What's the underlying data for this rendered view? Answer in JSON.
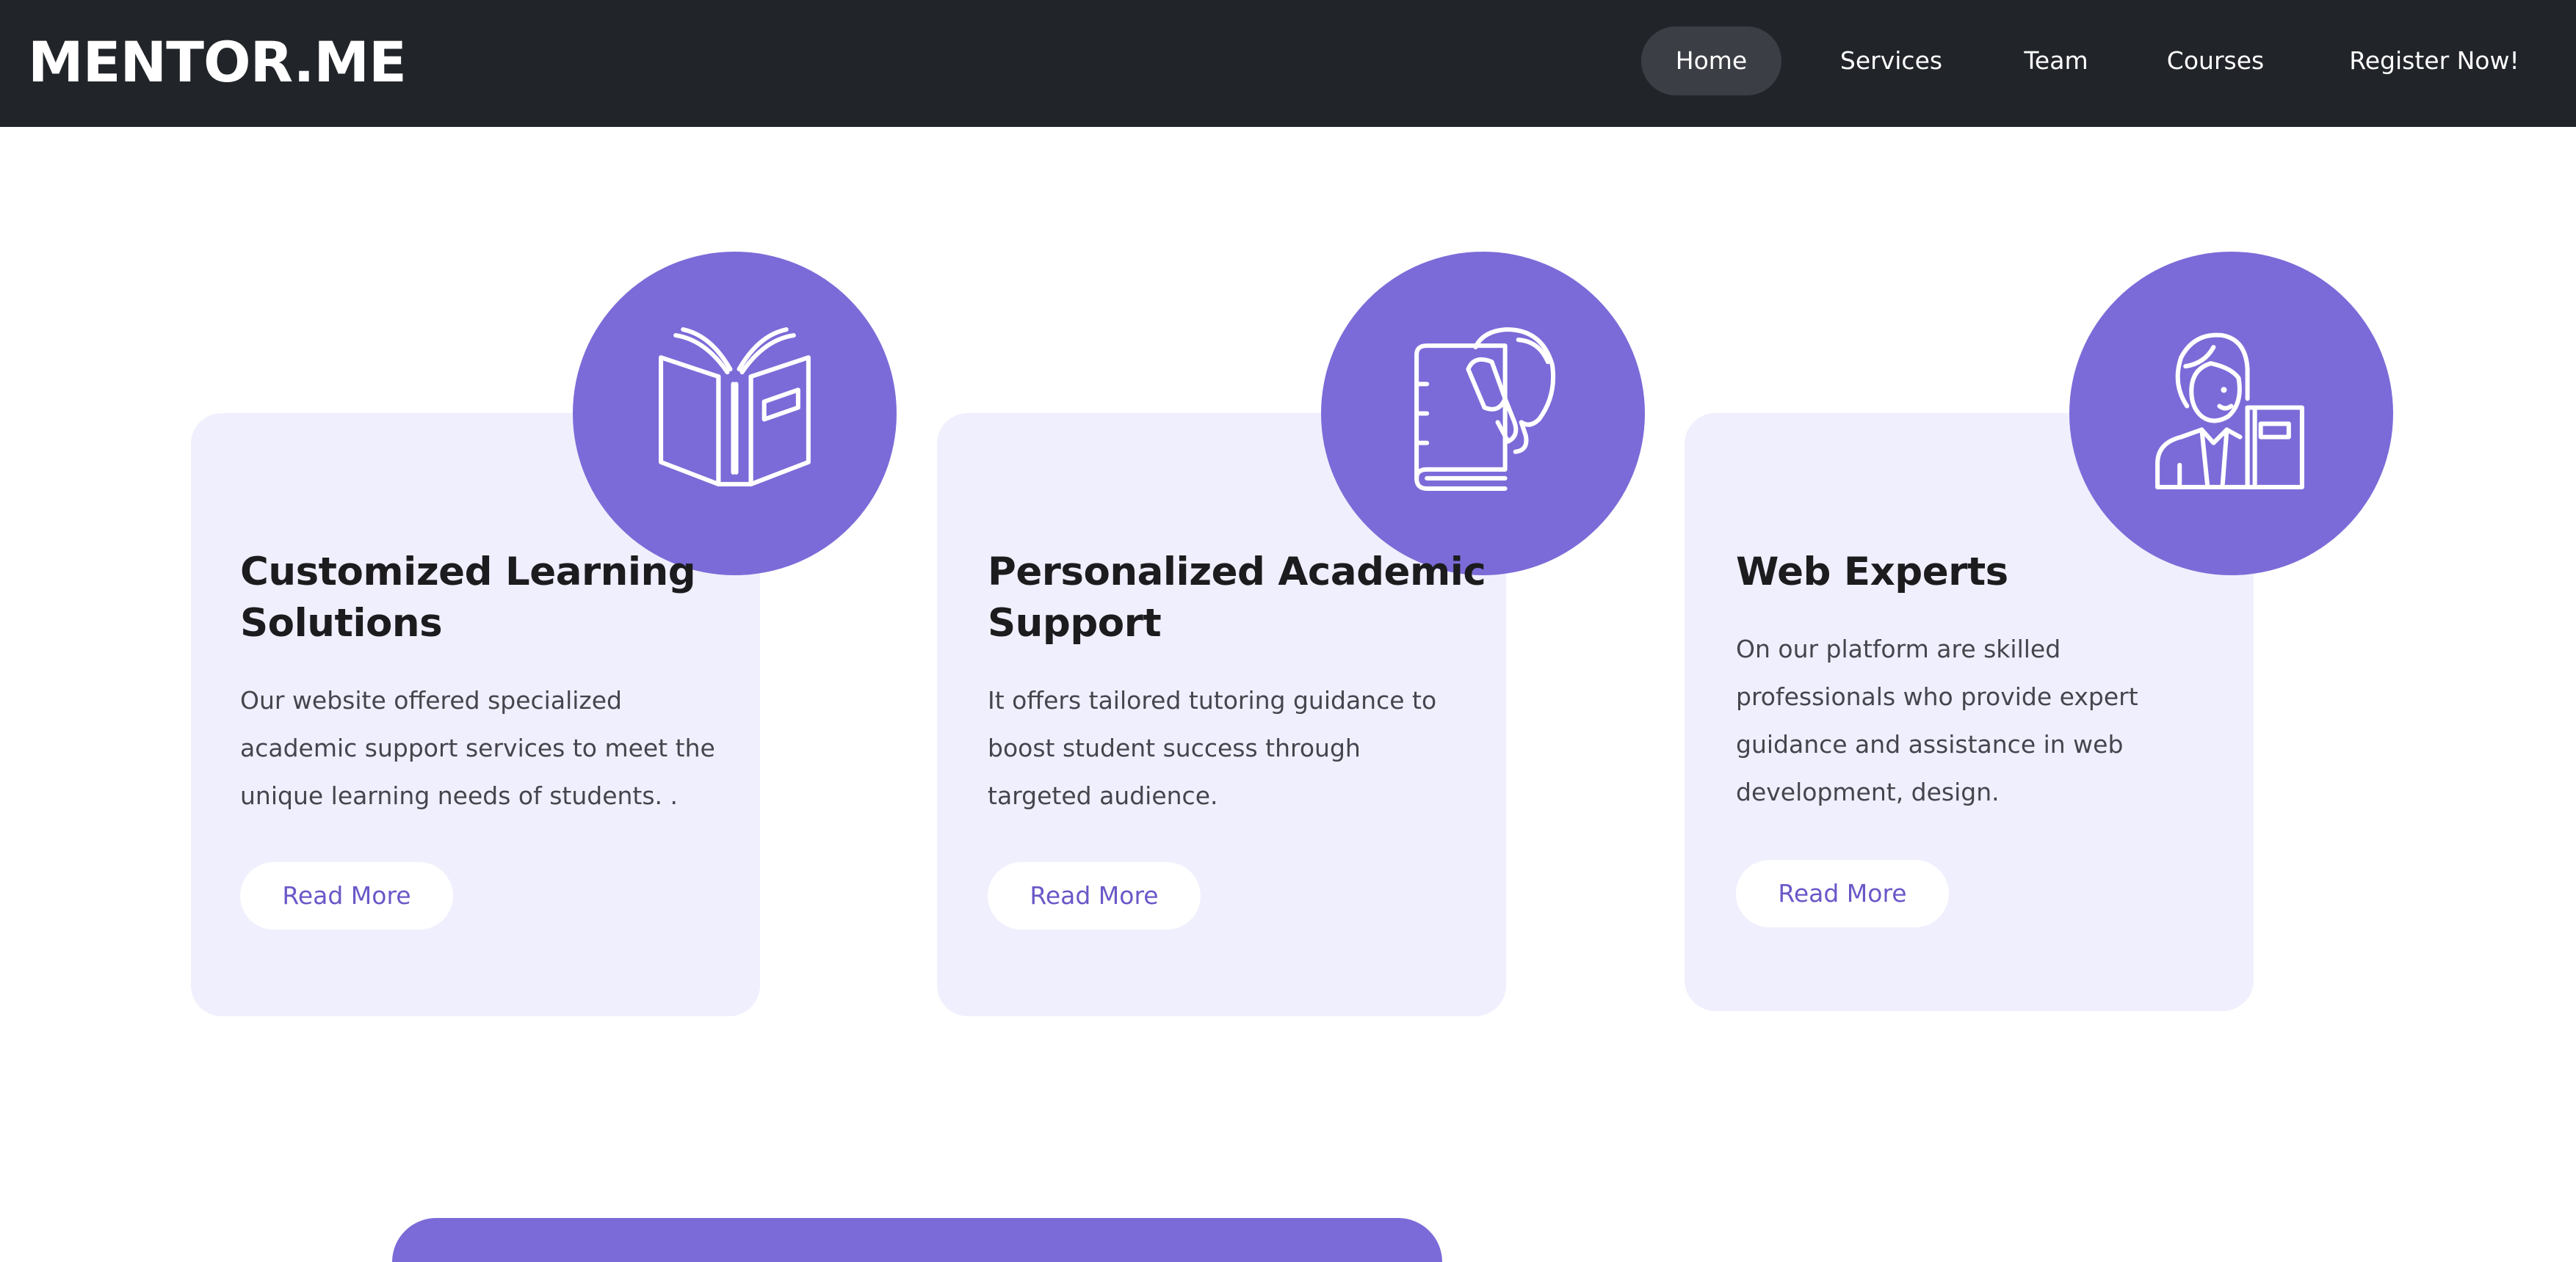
{
  "brand": {
    "name": "MENTOR.ME"
  },
  "nav": {
    "items": [
      {
        "label": "Home",
        "active": true
      },
      {
        "label": "Services"
      },
      {
        "label": "Team"
      },
      {
        "label": "Courses"
      },
      {
        "label": "Register Now!"
      }
    ]
  },
  "cards": [
    {
      "icon": "open-book-icon",
      "title_line1": "Customized Learning",
      "title_line2": "Solutions",
      "text_lines": [
        "Our website offered specialized",
        "academic support services to meet the",
        "unique learning needs of students. ."
      ],
      "button": "Read More"
    },
    {
      "icon": "book-hand-icon",
      "title_line1": "Personalized Academic",
      "title_line2": "Support",
      "text_lines": [
        "It offers tailored tutoring guidance to",
        "boost student success through",
        "targeted audience."
      ],
      "button": "Read More"
    },
    {
      "icon": "teacher-book-icon",
      "title_line1": "Web Experts",
      "text_lines": [
        "On our platform are skilled",
        "professionals who provide expert",
        "guidance and assistance in web",
        "development, design."
      ],
      "button": "Read More"
    }
  ],
  "colors": {
    "navbar": "#212429",
    "accent": "#7b6bd8",
    "card_bg": "#f0effd",
    "button_text": "#6a58c8"
  }
}
